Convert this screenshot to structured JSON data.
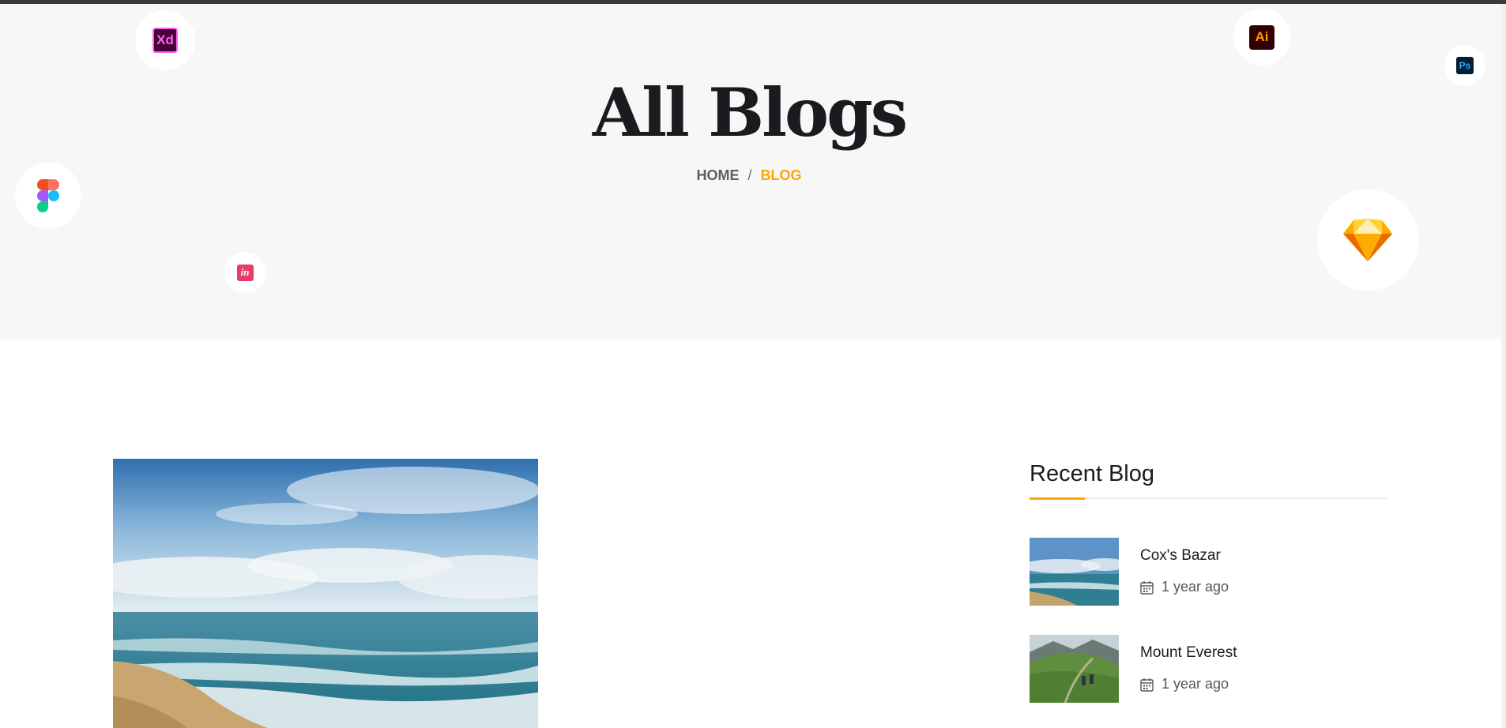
{
  "hero": {
    "title": "All Blogs",
    "breadcrumb": {
      "home": "HOME",
      "separator": "/",
      "current": "BLOG"
    }
  },
  "floating_icons": [
    {
      "name": "adobe-xd-icon",
      "label": "Xd"
    },
    {
      "name": "adobe-illustrator-icon",
      "label": "Ai"
    },
    {
      "name": "photoshop-icon",
      "label": "Ps"
    },
    {
      "name": "figma-icon"
    },
    {
      "name": "invision-icon",
      "label": "in"
    },
    {
      "name": "sketch-icon"
    }
  ],
  "sidebar": {
    "title": "Recent Blog",
    "items": [
      {
        "title": "Cox's Bazar",
        "date": "1 year ago",
        "thumb": "beach"
      },
      {
        "title": "Mount Everest",
        "date": "1 year ago",
        "thumb": "mountain"
      }
    ]
  },
  "colors": {
    "accent": "#ffa500",
    "hero_bg": "#f7f7f7",
    "text_dark": "#1b1b1f"
  }
}
